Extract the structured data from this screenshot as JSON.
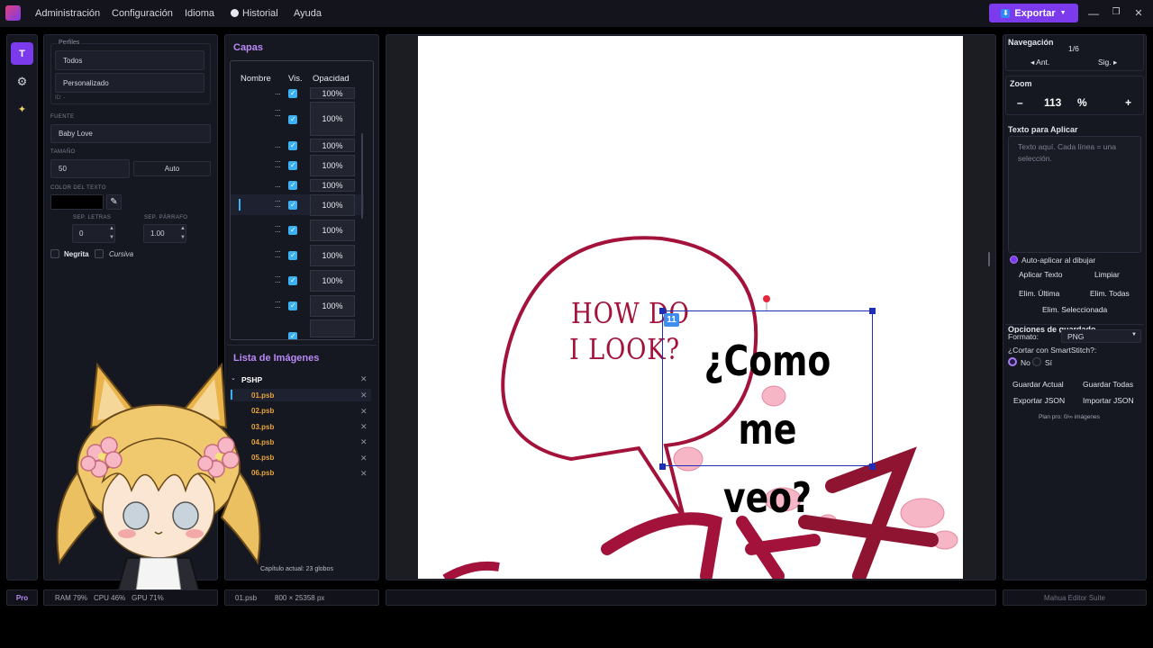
{
  "menubar": {
    "items": [
      "Administración",
      "Configuración",
      "Idioma",
      "Historial",
      "Ayuda"
    ],
    "export_label": "Exportar",
    "export_caret": "▼"
  },
  "window_controls": {
    "minimize": "—",
    "restore": "❐",
    "close": "✕"
  },
  "toolbar": {
    "items": [
      {
        "label": "T",
        "icon": "text-tool-icon"
      },
      {
        "label": "⚙",
        "icon": "gear-icon"
      },
      {
        "label": "✦",
        "icon": "sparkle-icon"
      }
    ]
  },
  "font_panel": {
    "profiles_label": "Perfiles",
    "profile_all": "Todos",
    "profile_custom": "Personalizado",
    "id_label": "ID: -",
    "font_label": "FUENTE",
    "font_value": "Baby Love",
    "size_label": "TAMAÑO",
    "size_value": "50",
    "auto_label": "Auto",
    "color_label": "COLOR DEL TEXTO",
    "color_value": "#000000",
    "letter_spacing_label": "SEP. LETRAS",
    "letter_spacing_value": "0",
    "paragraph_spacing_label": "SEP. PÁRRAFO",
    "paragraph_spacing_value": "1.00",
    "bold_label": "Negrita",
    "italic_label": "Cursiva"
  },
  "layers": {
    "title": "Capas",
    "columns": [
      "Nombre",
      "Vis.",
      "Opacidad"
    ],
    "rows": [
      {
        "name": "...",
        "visible": true,
        "opacity": "100%"
      },
      {
        "name": "...",
        "visible": true,
        "opacity": "100%"
      },
      {
        "name": "...",
        "visible": true,
        "opacity": "100%"
      },
      {
        "name": "...",
        "visible": true,
        "opacity": "100%"
      },
      {
        "name": "...",
        "visible": true,
        "opacity": "100%"
      },
      {
        "name": "...",
        "visible": true,
        "opacity": "100%"
      },
      {
        "name": "...",
        "visible": true,
        "opacity": "100%"
      },
      {
        "name": "...",
        "visible": true,
        "opacity": "100%"
      },
      {
        "name": "...",
        "visible": true,
        "opacity": "100%"
      },
      {
        "name": "...",
        "visible": true,
        "opacity": "100%"
      }
    ]
  },
  "image_list": {
    "title": "Lista de Imágenes",
    "folder": "PSHP",
    "files": [
      "01.psb",
      "02.psb",
      "03.psb",
      "04.psb",
      "05.psb",
      "06.psb"
    ],
    "chapter_info": "Capítulo actual: 23 globos"
  },
  "canvas": {
    "bubble_text_line1": "HOW DO",
    "bubble_text_line2": "I LOOK?",
    "selection_badge": "11",
    "overlay_text_line1": "¿Como me",
    "overlay_text_line2": "veo?"
  },
  "right_panel": {
    "nav_title": "Navegación",
    "page_counter": "1/6",
    "prev_label": "◂ Ant.",
    "next_label": "Sig. ▸",
    "zoom_title": "Zoom",
    "zoom_minus": "–",
    "zoom_value": "113",
    "zoom_unit": "%",
    "zoom_plus": "+",
    "apply_title": "Texto para Aplicar",
    "apply_placeholder": "Texto aquí. Cada línea = una selección.",
    "auto_apply_label": "Auto-aplicar al dibujar",
    "apply_button": "Aplicar Texto",
    "clear_button": "Limpiar",
    "delete_last": "Elim. Última",
    "delete_all": "Elim. Todas",
    "delete_selected": "Elim. Seleccionada",
    "save_options_title": "Opciones de guardado",
    "format_label": "Formato:",
    "format_value": "PNG",
    "smartstitch_label": "¿Cortar con SmartStitch?:",
    "no_label": "No",
    "yes_label": "Sí",
    "save_current": "Guardar Actual",
    "save_all": "Guardar Todas",
    "export_json": "Exportar JSON",
    "import_json": "Importar JSON",
    "plan_info": "Plan pro: 0/∞ imágenes"
  },
  "statusbar": {
    "plan": "Pro",
    "ram": "RAM 79%",
    "cpu": "CPU 46%",
    "gpu": "GPU 71%",
    "file": "01.psb",
    "dimensions": "800 × 25358 px",
    "app_name": "Mahua Editor Suite"
  },
  "colors": {
    "accent": "#7c3aed",
    "section": "#b889f5",
    "checkbox": "#3db0f2",
    "file": "#e8a43c",
    "selection": "#1f2fb5",
    "bubble": "#a3123a"
  }
}
